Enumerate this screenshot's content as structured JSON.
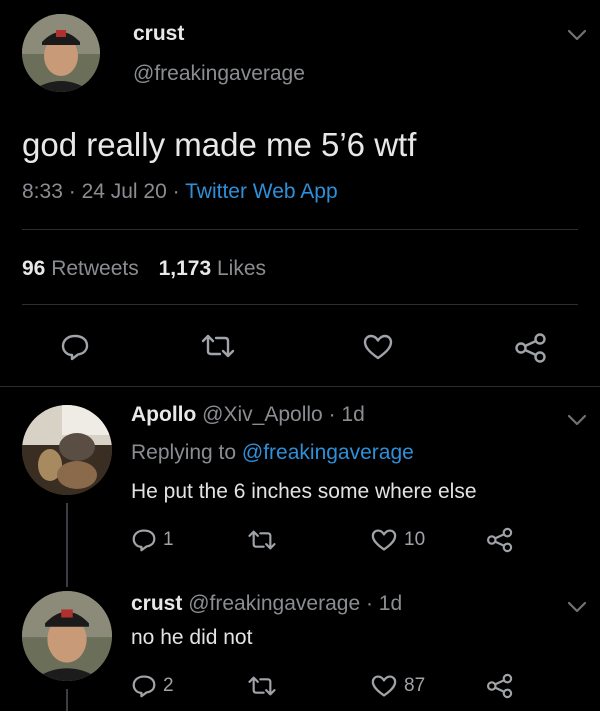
{
  "main_tweet": {
    "display_name": "crust",
    "handle": "@freakingaverage",
    "text": "god really made me 5’6 wtf",
    "time": "8:33",
    "date": "24 Jul 20",
    "source": "Twitter Web App",
    "sep": "·",
    "retweets_count": "96",
    "retweets_label": "Retweets",
    "likes_count": "1,173",
    "likes_label": "Likes"
  },
  "reply1": {
    "display_name": "Apollo",
    "handle": "@Xiv_Apollo",
    "age": "· 1d",
    "replying_prefix": "Replying to",
    "replying_handle": "@freakingaverage",
    "text": "He put the 6 inches some where else",
    "reply_count": "1",
    "like_count": "10"
  },
  "reply2": {
    "display_name": "crust",
    "handle": "@freakingaverage",
    "age": "· 1d",
    "text": "no he did not",
    "reply_count": "2",
    "like_count": "87"
  },
  "icons": [
    "chevron-down-icon",
    "reply-icon",
    "retweet-icon",
    "like-icon",
    "share-icon"
  ],
  "colors": {
    "background": "#000000",
    "link": "#2f8fd8",
    "muted": "#8a8d91",
    "divider": "#2a2d31"
  }
}
